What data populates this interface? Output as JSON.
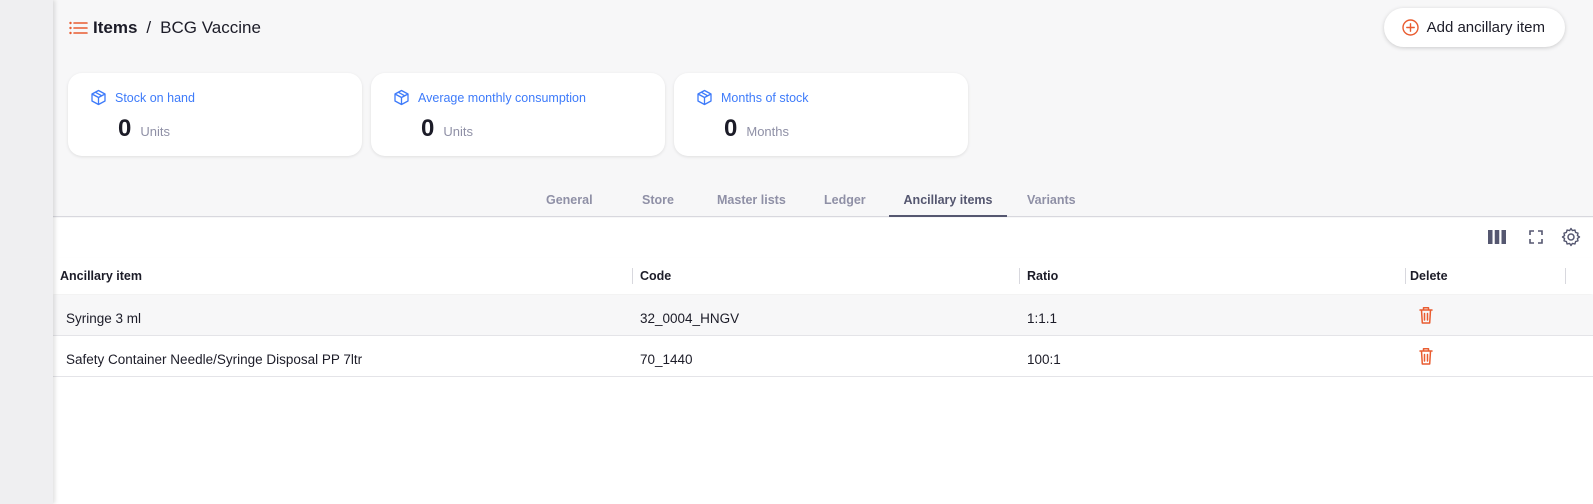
{
  "breadcrumb": {
    "root": "Items",
    "separator": "/",
    "current": "BCG Vaccine"
  },
  "actions": {
    "add_label": "Add ancillary item"
  },
  "stats": [
    {
      "label": "Stock on hand",
      "value": "0",
      "unit": "Units",
      "icon": "box-icon"
    },
    {
      "label": "Average monthly consumption",
      "value": "0",
      "unit": "Units",
      "icon": "box-icon"
    },
    {
      "label": "Months of stock",
      "value": "0",
      "unit": "Months",
      "icon": "box-icon"
    }
  ],
  "tabs": [
    {
      "label": "General",
      "active": false
    },
    {
      "label": "Store",
      "active": false
    },
    {
      "label": "Master lists",
      "active": false
    },
    {
      "label": "Ledger",
      "active": false
    },
    {
      "label": "Ancillary items",
      "active": true
    },
    {
      "label": "Variants",
      "active": false
    }
  ],
  "table": {
    "headers": [
      "Ancillary item",
      "Code",
      "Ratio",
      "Delete"
    ],
    "rows": [
      {
        "item": "Syringe 3 ml",
        "code": "32_0004_HNGV",
        "ratio": "1:1.1"
      },
      {
        "item": "Safety Container Needle/Syringe Disposal PP 7ltr",
        "code": "70_1440",
        "ratio": "100:1"
      }
    ]
  },
  "colors": {
    "accent": "#e95c30",
    "link_blue": "#3e7bfa",
    "muted": "#8f90a6",
    "active_tab": "#555770"
  }
}
